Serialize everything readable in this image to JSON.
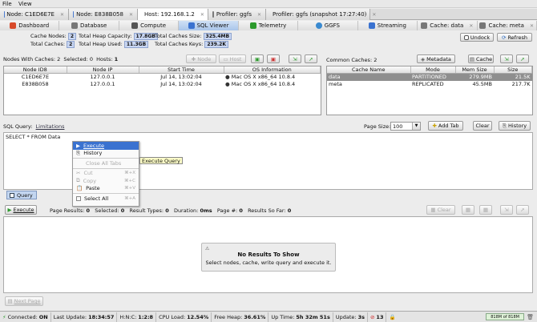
{
  "menu": {
    "file": "File",
    "view": "View"
  },
  "node_tabs": [
    {
      "label": "Node: C1ED6E7E",
      "icon": "node-icon",
      "color": "#4a7bd0"
    },
    {
      "label": "Node: E838B058",
      "icon": "node-icon",
      "color": "#4a7bd0"
    },
    {
      "label": "Host: 192.168.1.2",
      "icon": "host-icon",
      "color": "#6a6a6a"
    },
    {
      "label": "Profiler: ggfs",
      "icon": "profiler-icon",
      "color": "#7a7a7a"
    },
    {
      "label": "Profiler: ggfs (snapshot 17:27:40)",
      "icon": "profiler-icon",
      "color": "#7a7a7a"
    }
  ],
  "sub_tabs": [
    {
      "label": "Dashboard",
      "icon": "dashboard-icon",
      "color": "#d84a2a"
    },
    {
      "label": "Database",
      "icon": "database-icon",
      "color": "#777"
    },
    {
      "label": "Compute",
      "icon": "compute-icon",
      "color": "#555"
    },
    {
      "label": "SQL Viewer",
      "icon": "sql-icon",
      "color": "#3a72d0"
    },
    {
      "label": "Telemetry",
      "icon": "telemetry-icon",
      "color": "#2c9a2c"
    },
    {
      "label": "GGFS",
      "icon": "ggfs-icon",
      "color": "#3a8ad0"
    },
    {
      "label": "Streaming",
      "icon": "streaming-icon",
      "color": "#3a72d0"
    },
    {
      "label": "Cache: data",
      "icon": "cache-icon",
      "color": "#777"
    },
    {
      "label": "Cache: meta",
      "icon": "cache-icon",
      "color": "#777"
    }
  ],
  "summary": {
    "cache_nodes_label": "Cache Nodes:",
    "cache_nodes": "2",
    "total_caches_label": "Total Caches:",
    "total_caches": "2",
    "heap_capacity_label": "Total Heap Capacity:",
    "heap_capacity": "17.8GB",
    "heap_used_label": "Total Heap Used:",
    "heap_used": "11.3GB",
    "caches_size_label": "Total Caches Size:",
    "caches_size": "325.4MB",
    "caches_keys_label": "Total Caches Keys:",
    "caches_keys": "239.2K",
    "undock": "Undock",
    "refresh": "Refresh"
  },
  "nodes_bar": {
    "label": "Nodes With Caches:",
    "count": "2",
    "selected_label": "Selected:",
    "selected": "0",
    "hosts_label": "Hosts:",
    "hosts": "1",
    "node_btn": "Node",
    "host_btn": "Host"
  },
  "nodes_table": {
    "headers": [
      "Node ID8",
      "Node IP",
      "Start Time",
      "OS Information"
    ],
    "rows": [
      [
        "C1ED6E7E",
        "127.0.0.1",
        "Jul 14, 13:02:04",
        "Mac OS X x86_64 10.8.4"
      ],
      [
        "E838B058",
        "127.0.0.1",
        "Jul 14, 13:02:04",
        "Mac OS X x86_64 10.8.4"
      ]
    ]
  },
  "caches_bar": {
    "label": "Common Caches:",
    "count": "2",
    "metadata": "Metadata",
    "cache": "Cache"
  },
  "caches_table": {
    "headers": [
      "Cache Name",
      "Mode",
      "Mem Size",
      "Size"
    ],
    "rows": [
      [
        "data",
        "PARTITIONED",
        "279.9MB",
        "21.5K"
      ],
      [
        "meta",
        "REPLICATED",
        "45.5MB",
        "217.7K"
      ]
    ]
  },
  "query_bar": {
    "label": "SQL Query:",
    "limitations": "Limitations",
    "page_size_label": "Page Size:",
    "page_size": "100",
    "add_tab": "Add Tab",
    "clear": "Clear",
    "history": "History"
  },
  "query_text": "SELECT * FROM Data",
  "context_menu": {
    "execute": "Execute",
    "history": "History",
    "close_all": "Close All Tabs",
    "cut": "Cut",
    "cut_sc": "⌘+X",
    "copy": "Copy",
    "copy_sc": "⌘+C",
    "paste": "Paste",
    "paste_sc": "⌘+V",
    "select_all": "Select All",
    "select_all_sc": "⌘+A"
  },
  "tooltip": "Execute Query",
  "query_tab": "Query",
  "results_bar": {
    "execute": "Execute",
    "page_results_label": "Page Results:",
    "page_results": "0",
    "selected_label": "Selected:",
    "selected": "0",
    "result_types_label": "Result Types:",
    "result_types": "0",
    "duration_label": "Duration:",
    "duration": "0ms",
    "page_label": "Page #:",
    "page": "0",
    "so_far_label": "Results So Far:",
    "so_far": "0",
    "clear": "Clear"
  },
  "empty": {
    "title": "No Results To Show",
    "subtitle": "Select nodes, cache, write query and execute it."
  },
  "next_page": "Next Page",
  "status": {
    "connected_label": "Connected:",
    "connected": "ON",
    "last_update_label": "Last Update:",
    "last_update": "18:34:57",
    "hnc_label": "H:N:C:",
    "hnc": "1:2:8",
    "cpu_label": "CPU Load:",
    "cpu": "12.54%",
    "heap_label": "Free Heap:",
    "heap": "36.61%",
    "uptime_label": "Up Time:",
    "uptime": "5h 32m 51s",
    "update_label": "Update:",
    "update": "3s",
    "alerts": "13",
    "memory": "818M of 818M"
  },
  "colors": {
    "accent": "#3a72d0",
    "selected_row": "#8e8e8e",
    "tooltip_bg": "#ffffc8",
    "tab_active": "#a9c5ea"
  }
}
